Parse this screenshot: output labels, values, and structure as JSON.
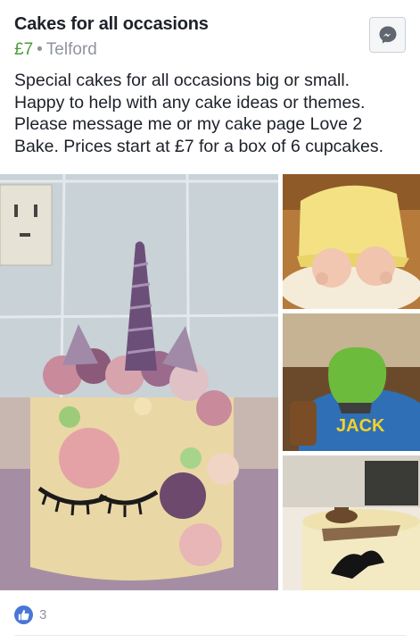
{
  "listing": {
    "title": "Cakes for all occasions",
    "price": "£7",
    "separator": "•",
    "location": "Telford",
    "description": "Special cakes for all occasions big or small.\nHappy to help with any cake ideas or themes.\nPlease message me or my cake page Love 2\nBake.  Prices start at £7 for a box of 6 cupcakes."
  },
  "actions": {
    "message_icon": "messenger-icon"
  },
  "photos": [
    {
      "name": "unicorn-cake-photo"
    },
    {
      "name": "baby-cake-photo"
    },
    {
      "name": "hulk-fist-cake-photo",
      "visible_text": "JACK"
    },
    {
      "name": "cowboy-cake-photo"
    }
  ],
  "reactions": {
    "icon": "thumbs-up-icon",
    "count": "3"
  },
  "colors": {
    "price": "#4b9b3c",
    "muted": "#90949c",
    "like": "#4a76d6",
    "messenger": "#606770"
  }
}
